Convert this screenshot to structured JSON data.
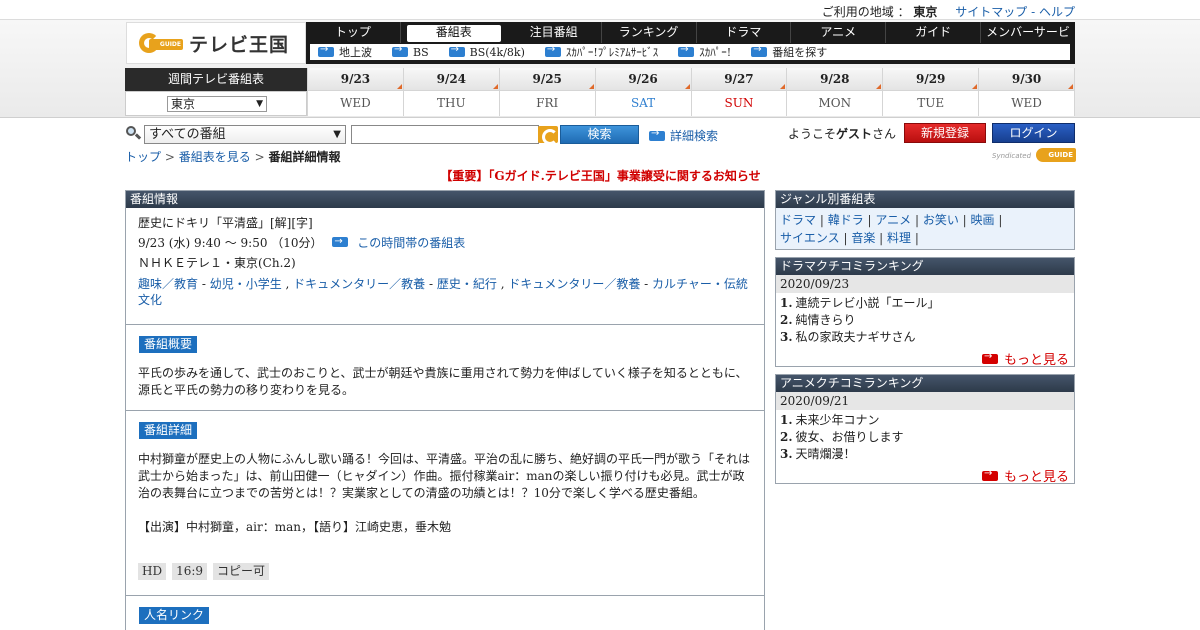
{
  "topbar": {
    "region_label": "ご利用の地域 ：",
    "region_value": "東京",
    "sitemap": "サイトマップ",
    "dash": "-",
    "help": "ヘルプ"
  },
  "logo": {
    "text": "テレビ王国",
    "g_text": "GUIDE"
  },
  "mainnav": {
    "tabs": [
      "トップ",
      "番組表",
      "注目番組",
      "ランキング",
      "ドラマ",
      "アニメ",
      "ガイド",
      "メンバーサービス"
    ]
  },
  "subnav": {
    "items": [
      "地上波",
      "BS",
      "BS(4k/8k)",
      "ｽｶﾊﾟｰ!ﾌﾟﾚﾐｱﾑｻｰﾋﾞｽ",
      "ｽｶﾊﾟｰ!",
      "番組を探す"
    ]
  },
  "schedule": {
    "title": "週間テレビ番組表",
    "region_select": "東京",
    "days": [
      {
        "date": "9/23",
        "dow": "WED",
        "color": "#555555"
      },
      {
        "date": "9/24",
        "dow": "THU",
        "color": "#555555"
      },
      {
        "date": "9/25",
        "dow": "FRI",
        "color": "#555555"
      },
      {
        "date": "9/26",
        "dow": "SAT",
        "color": "#2f7fd0"
      },
      {
        "date": "9/27",
        "dow": "SUN",
        "color": "#d00000"
      },
      {
        "date": "9/28",
        "dow": "MON",
        "color": "#555555"
      },
      {
        "date": "9/29",
        "dow": "TUE",
        "color": "#555555"
      },
      {
        "date": "9/30",
        "dow": "WED",
        "color": "#555555"
      }
    ]
  },
  "search": {
    "category": "すべての番組",
    "query": "",
    "button": "検索",
    "advanced": "詳細検索"
  },
  "account": {
    "welcome_prefix": "ようこそ",
    "guest": "ゲスト",
    "welcome_suffix": "さん",
    "register": "新規登録",
    "login": "ログイン"
  },
  "breadcrumb": {
    "top": "トップ",
    "schedule": "番組表を見る",
    "current": "番組詳細情報",
    "sep": ">"
  },
  "syndicated": {
    "text": "Syndicated",
    "g_text": "GUIDE"
  },
  "notice": "【重要】「Gガイド.テレビ王国」事業譲受に関するお知らせ",
  "program": {
    "panel_title": "番組情報",
    "title": "歴史にドキリ「平清盛」[解][字]",
    "time": "9/23 (水) 9:40 ～ 9:50 （10分）",
    "timeslot_link": "この時間帯の番組表",
    "channel": "ＮＨＫＥテレ１・東京(Ch.2)",
    "genres": [
      {
        "text": "趣味／教育",
        "sep": " - "
      },
      {
        "text": "幼児・小学生",
        "sep": " , "
      },
      {
        "text": "ドキュメンタリー／教養",
        "sep": " - "
      },
      {
        "text": "歴史・紀行",
        "sep": " , "
      },
      {
        "text": "ドキュメンタリー／教養",
        "sep": " - "
      },
      {
        "text": "カルチャー・伝統文化",
        "sep": ""
      }
    ],
    "overview_label": "番組概要",
    "overview": "平氏の歩みを通して、武士のおこりと、武士が朝廷や貴族に重用されて勢力を伸ばしていく様子を知るとともに、源氏と平氏の勢力の移り変わりを見る。",
    "detail_label": "番組詳細",
    "detail": "中村獅童が歴史上の人物にふんし歌い踊る！今回は、平清盛。平治の乱に勝ち、絶好調の平氏一門が歌う「それは武士から始まった」は、前山田健一（ヒャダイン）作曲。振付稼業air：manの楽しい振り付けも必見。武士が政治の表舞台に立つまでの苦労とは！？実業家としての清盛の功績とは！？10分で楽しく学べる歴史番組。",
    "cast": "【出演】中村獅童，air：man，【語り】江崎史恵，垂木勉",
    "badges": [
      "HD",
      "16:9",
      "コピー可"
    ],
    "people_label": "人名リンク"
  },
  "sidebar": {
    "genre_title": "ジャンル別番組表",
    "genre_links": [
      [
        "ドラマ",
        "韓ドラ",
        "アニメ",
        "お笑い",
        "映画"
      ],
      [
        "サイエンス",
        "音楽",
        "料理"
      ]
    ],
    "drama_title": "ドラマクチコミランキング",
    "drama_date": "2020/09/23",
    "drama_items": [
      "連続テレビ小説「エール」",
      "純情きらり",
      "私の家政夫ナギサさん"
    ],
    "anime_title": "アニメクチコミランキング",
    "anime_date": "2020/09/21",
    "anime_items": [
      "未来少年コナン",
      "彼女、お借りします",
      "天晴爛漫！"
    ],
    "more": "もっと見る"
  }
}
